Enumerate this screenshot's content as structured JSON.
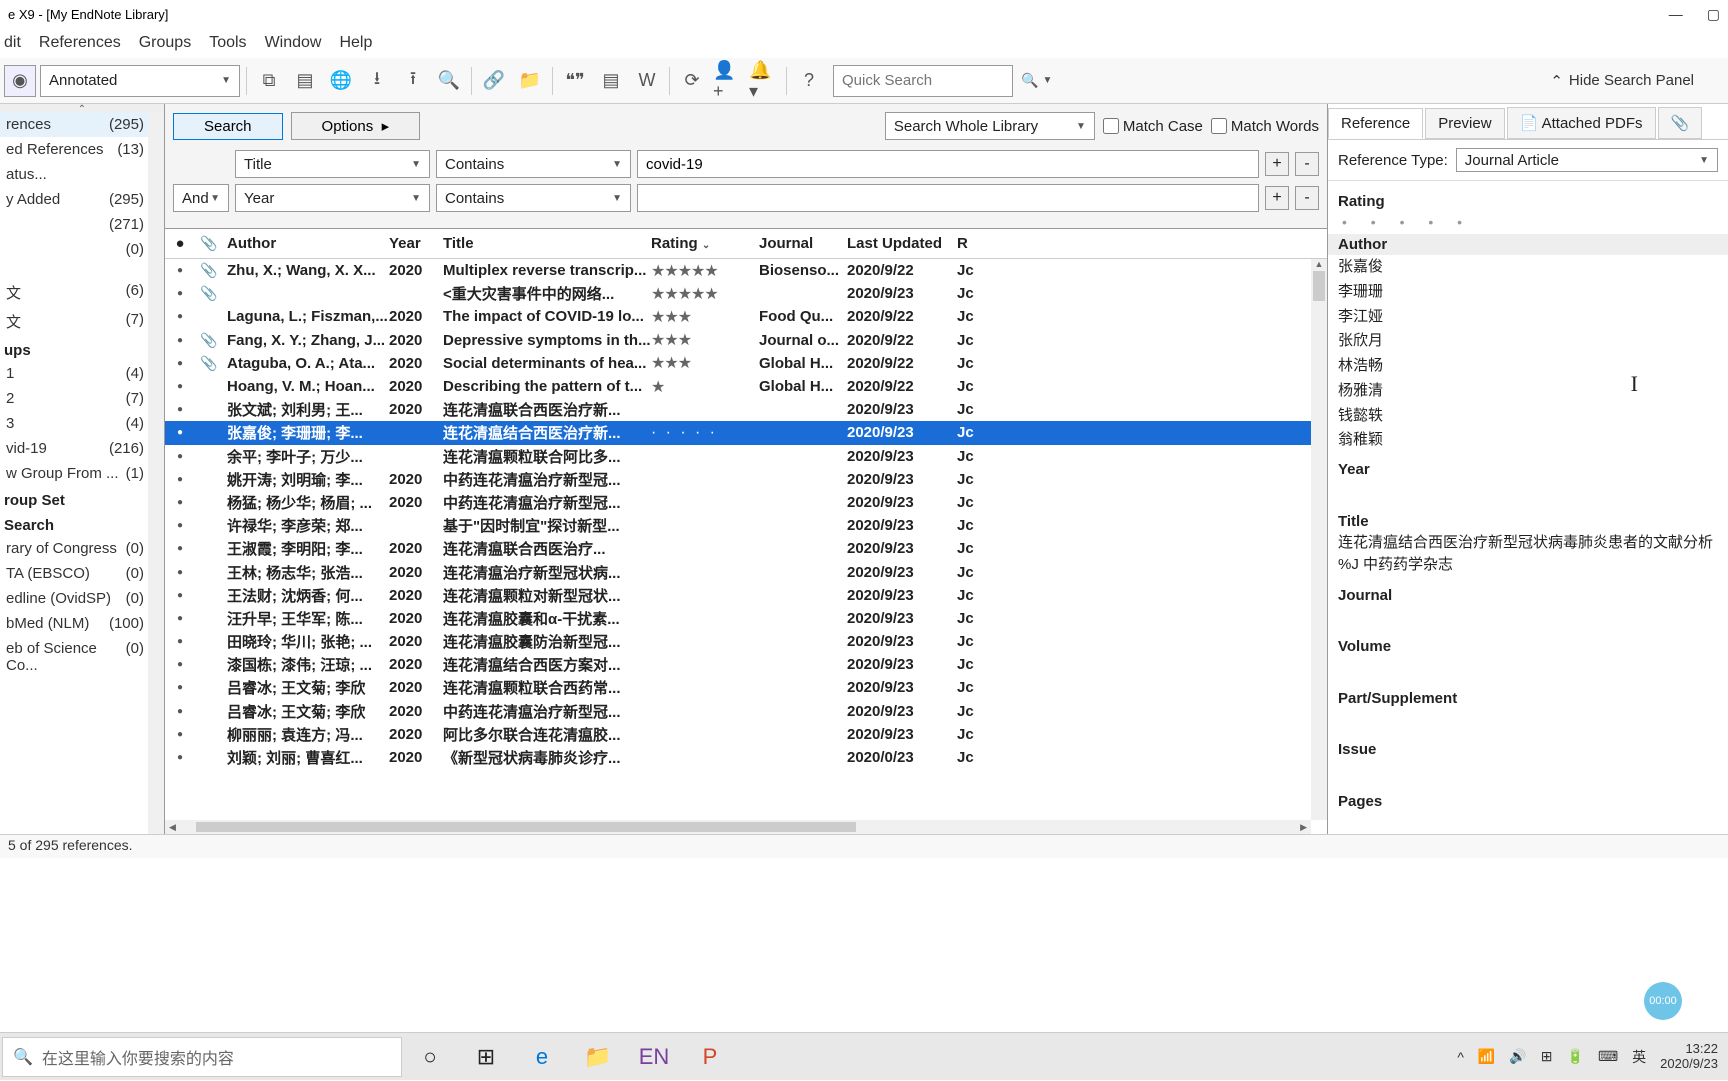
{
  "window": {
    "title": "e X9 - [My EndNote Library]"
  },
  "menu": {
    "items": [
      "dit",
      "References",
      "Groups",
      "Tools",
      "Window",
      "Help"
    ]
  },
  "toolbar": {
    "mode": "Annotated",
    "quicksearch_ph": "Quick Search",
    "hide_panel": "Hide Search Panel"
  },
  "sidebar": {
    "items": [
      {
        "label": "rences",
        "count": "(295)",
        "sel": true
      },
      {
        "label": "ed References",
        "count": "(13)"
      },
      {
        "label": "atus...",
        "count": ""
      },
      {
        "label": "y Added",
        "count": "(295)"
      },
      {
        "label": "",
        "count": "(271)"
      },
      {
        "label": "",
        "count": "(0)"
      }
    ],
    "groupA": [
      {
        "label": "文",
        "count": "(6)"
      },
      {
        "label": "文",
        "count": "(7)"
      }
    ],
    "header_groups": "ups",
    "groupB": [
      {
        "label": "1",
        "count": "(4)"
      },
      {
        "label": "2",
        "count": "(7)"
      },
      {
        "label": "3",
        "count": "(4)"
      },
      {
        "label": "vid-19",
        "count": "(216)"
      },
      {
        "label": "w Group From ...",
        "count": "(1)"
      }
    ],
    "header_set": "roup Set",
    "header_search": "Search",
    "online": [
      {
        "label": "rary of Congress",
        "count": "(0)"
      },
      {
        "label": "TA (EBSCO)",
        "count": "(0)"
      },
      {
        "label": "edline (OvidSP)",
        "count": "(0)"
      },
      {
        "label": "bMed (NLM)",
        "count": "(100)"
      },
      {
        "label": "eb of Science Co...",
        "count": "(0)"
      }
    ]
  },
  "search": {
    "btn_search": "Search",
    "btn_options": "Options",
    "scope": "Search Whole Library",
    "match_case": "Match Case",
    "match_words": "Match Words",
    "row1": {
      "field": "Title",
      "op": "Contains",
      "value": "covid-19"
    },
    "row2": {
      "bool": "And",
      "field": "Year",
      "op": "Contains",
      "value": ""
    }
  },
  "grid": {
    "headers": {
      "author": "Author",
      "year": "Year",
      "title": "Title",
      "rating": "Rating",
      "journal": "Journal",
      "updated": "Last Updated",
      "r": "R"
    },
    "rows": [
      {
        "clip": true,
        "author": "Zhu, X.; Wang, X. X...",
        "year": "2020",
        "title": "Multiplex reverse transcrip...",
        "rating": 5,
        "journal": "Biosenso...",
        "updated": "2020/9/22",
        "r": "Jc"
      },
      {
        "clip": true,
        "author": "",
        "year": "",
        "title": "<重大灾害事件中的网络...",
        "rating": 5,
        "journal": "",
        "updated": "2020/9/23",
        "r": "Jc"
      },
      {
        "author": "Laguna, L.; Fiszman,...",
        "year": "2020",
        "title": "The impact of COVID-19 lo...",
        "rating": 3,
        "journal": "Food Qu...",
        "updated": "2020/9/22",
        "r": "Jc"
      },
      {
        "clip": true,
        "author": "Fang, X. Y.; Zhang, J...",
        "year": "2020",
        "title": "Depressive symptoms in th...",
        "rating": 3,
        "journal": "Journal o...",
        "updated": "2020/9/22",
        "r": "Jc"
      },
      {
        "clip": true,
        "author": "Ataguba, O. A.; Ata...",
        "year": "2020",
        "title": "Social determinants of hea...",
        "rating": 3,
        "journal": "Global H...",
        "updated": "2020/9/22",
        "r": "Jc"
      },
      {
        "author": "Hoang, V. M.; Hoan...",
        "year": "2020",
        "title": "Describing the pattern of t...",
        "rating": 1,
        "journal": "Global H...",
        "updated": "2020/9/22",
        "r": "Jc"
      },
      {
        "author": "张文斌; 刘利男; 王...",
        "year": "2020",
        "title": "连花清瘟联合西医治疗新...",
        "rating": 0,
        "journal": "",
        "updated": "2020/9/23",
        "r": "Jc"
      },
      {
        "sel": true,
        "author": "张嘉俊; 李珊珊; 李...",
        "year": "",
        "title": "连花清瘟结合西医治疗新...",
        "rating": 0,
        "dots": true,
        "journal": "",
        "updated": "2020/9/23",
        "r": "Jc"
      },
      {
        "author": "余平; 李叶子; 万少...",
        "year": "",
        "title": "连花清瘟颗粒联合阿比多...",
        "rating": 0,
        "journal": "",
        "updated": "2020/9/23",
        "r": "Jc"
      },
      {
        "author": "姚开涛; 刘明瑜; 李...",
        "year": "2020",
        "title": "中药连花清瘟治疗新型冠...",
        "rating": 0,
        "journal": "",
        "updated": "2020/9/23",
        "r": "Jc"
      },
      {
        "author": "杨猛; 杨少华; 杨眉; ...",
        "year": "2020",
        "title": "中药连花清瘟治疗新型冠...",
        "rating": 0,
        "journal": "",
        "updated": "2020/9/23",
        "r": "Jc"
      },
      {
        "author": "许禄华; 李彦荣; 郑...",
        "year": "",
        "title": "基于\"因时制宜\"探讨新型...",
        "rating": 0,
        "journal": "",
        "updated": "2020/9/23",
        "r": "Jc"
      },
      {
        "author": "王淑霞; 李明阳; 李...",
        "year": "2020",
        "title": "连花清瘟联合西医治疗...",
        "rating": 0,
        "journal": "",
        "updated": "2020/9/23",
        "r": "Jc"
      },
      {
        "author": "王林; 杨志华; 张浩...",
        "year": "2020",
        "title": "连花清瘟治疗新型冠状病...",
        "rating": 0,
        "journal": "",
        "updated": "2020/9/23",
        "r": "Jc"
      },
      {
        "author": "王法财; 沈炳香; 何...",
        "year": "2020",
        "title": "连花清瘟颗粒对新型冠状...",
        "rating": 0,
        "journal": "",
        "updated": "2020/9/23",
        "r": "Jc"
      },
      {
        "author": "汪升早; 王华军; 陈...",
        "year": "2020",
        "title": "连花清瘟胶囊和α-干扰素...",
        "rating": 0,
        "journal": "",
        "updated": "2020/9/23",
        "r": "Jc"
      },
      {
        "author": "田晓玲; 华川; 张艳; ...",
        "year": "2020",
        "title": "连花清瘟胶囊防治新型冠...",
        "rating": 0,
        "journal": "",
        "updated": "2020/9/23",
        "r": "Jc"
      },
      {
        "author": "漆国栋; 漆伟; 汪琼; ...",
        "year": "2020",
        "title": "连花清瘟结合西医方案对...",
        "rating": 0,
        "journal": "",
        "updated": "2020/9/23",
        "r": "Jc"
      },
      {
        "author": "吕睿冰; 王文菊; 李欣",
        "year": "2020",
        "title": "连花清瘟颗粒联合西药常...",
        "rating": 0,
        "journal": "",
        "updated": "2020/9/23",
        "r": "Jc"
      },
      {
        "author": "吕睿冰; 王文菊; 李欣",
        "year": "2020",
        "title": "中药连花清瘟治疗新型冠...",
        "rating": 0,
        "journal": "",
        "updated": "2020/9/23",
        "r": "Jc"
      },
      {
        "author": "柳丽丽; 袁连方; 冯...",
        "year": "2020",
        "title": "阿比多尔联合连花清瘟胶...",
        "rating": 0,
        "journal": "",
        "updated": "2020/9/23",
        "r": "Jc"
      },
      {
        "author": "刘颖; 刘丽; 曹喜红...",
        "year": "2020",
        "title": "《新型冠状病毒肺炎诊疗...",
        "rating": 0,
        "journal": "",
        "updated": "2020/0/23",
        "r": "Jc"
      }
    ]
  },
  "right": {
    "tabs": {
      "ref": "Reference",
      "preview": "Preview",
      "pdf": "Attached PDFs"
    },
    "ref_type_label": "Reference Type:",
    "ref_type_value": "Journal Article",
    "labels": {
      "rating": "Rating",
      "author": "Author",
      "year": "Year",
      "title": "Title",
      "journal": "Journal",
      "volume": "Volume",
      "part": "Part/Supplement",
      "issue": "Issue",
      "pages": "Pages"
    },
    "authors": [
      "张嘉俊",
      "李珊珊",
      "李江娅",
      "张欣月",
      "林浩畅",
      "杨雅清",
      "钱懿轶",
      "翁稚颖"
    ],
    "title": "连花清瘟结合西医治疗新型冠状病毒肺炎患者的文献分析 %J 中药药学杂志"
  },
  "status": "5 of 295 references.",
  "taskbar": {
    "search_ph": "在这里输入你要搜索的内容",
    "time": "13:22",
    "date": "2020/9/23",
    "ime": "英",
    "rec": "00:00"
  }
}
